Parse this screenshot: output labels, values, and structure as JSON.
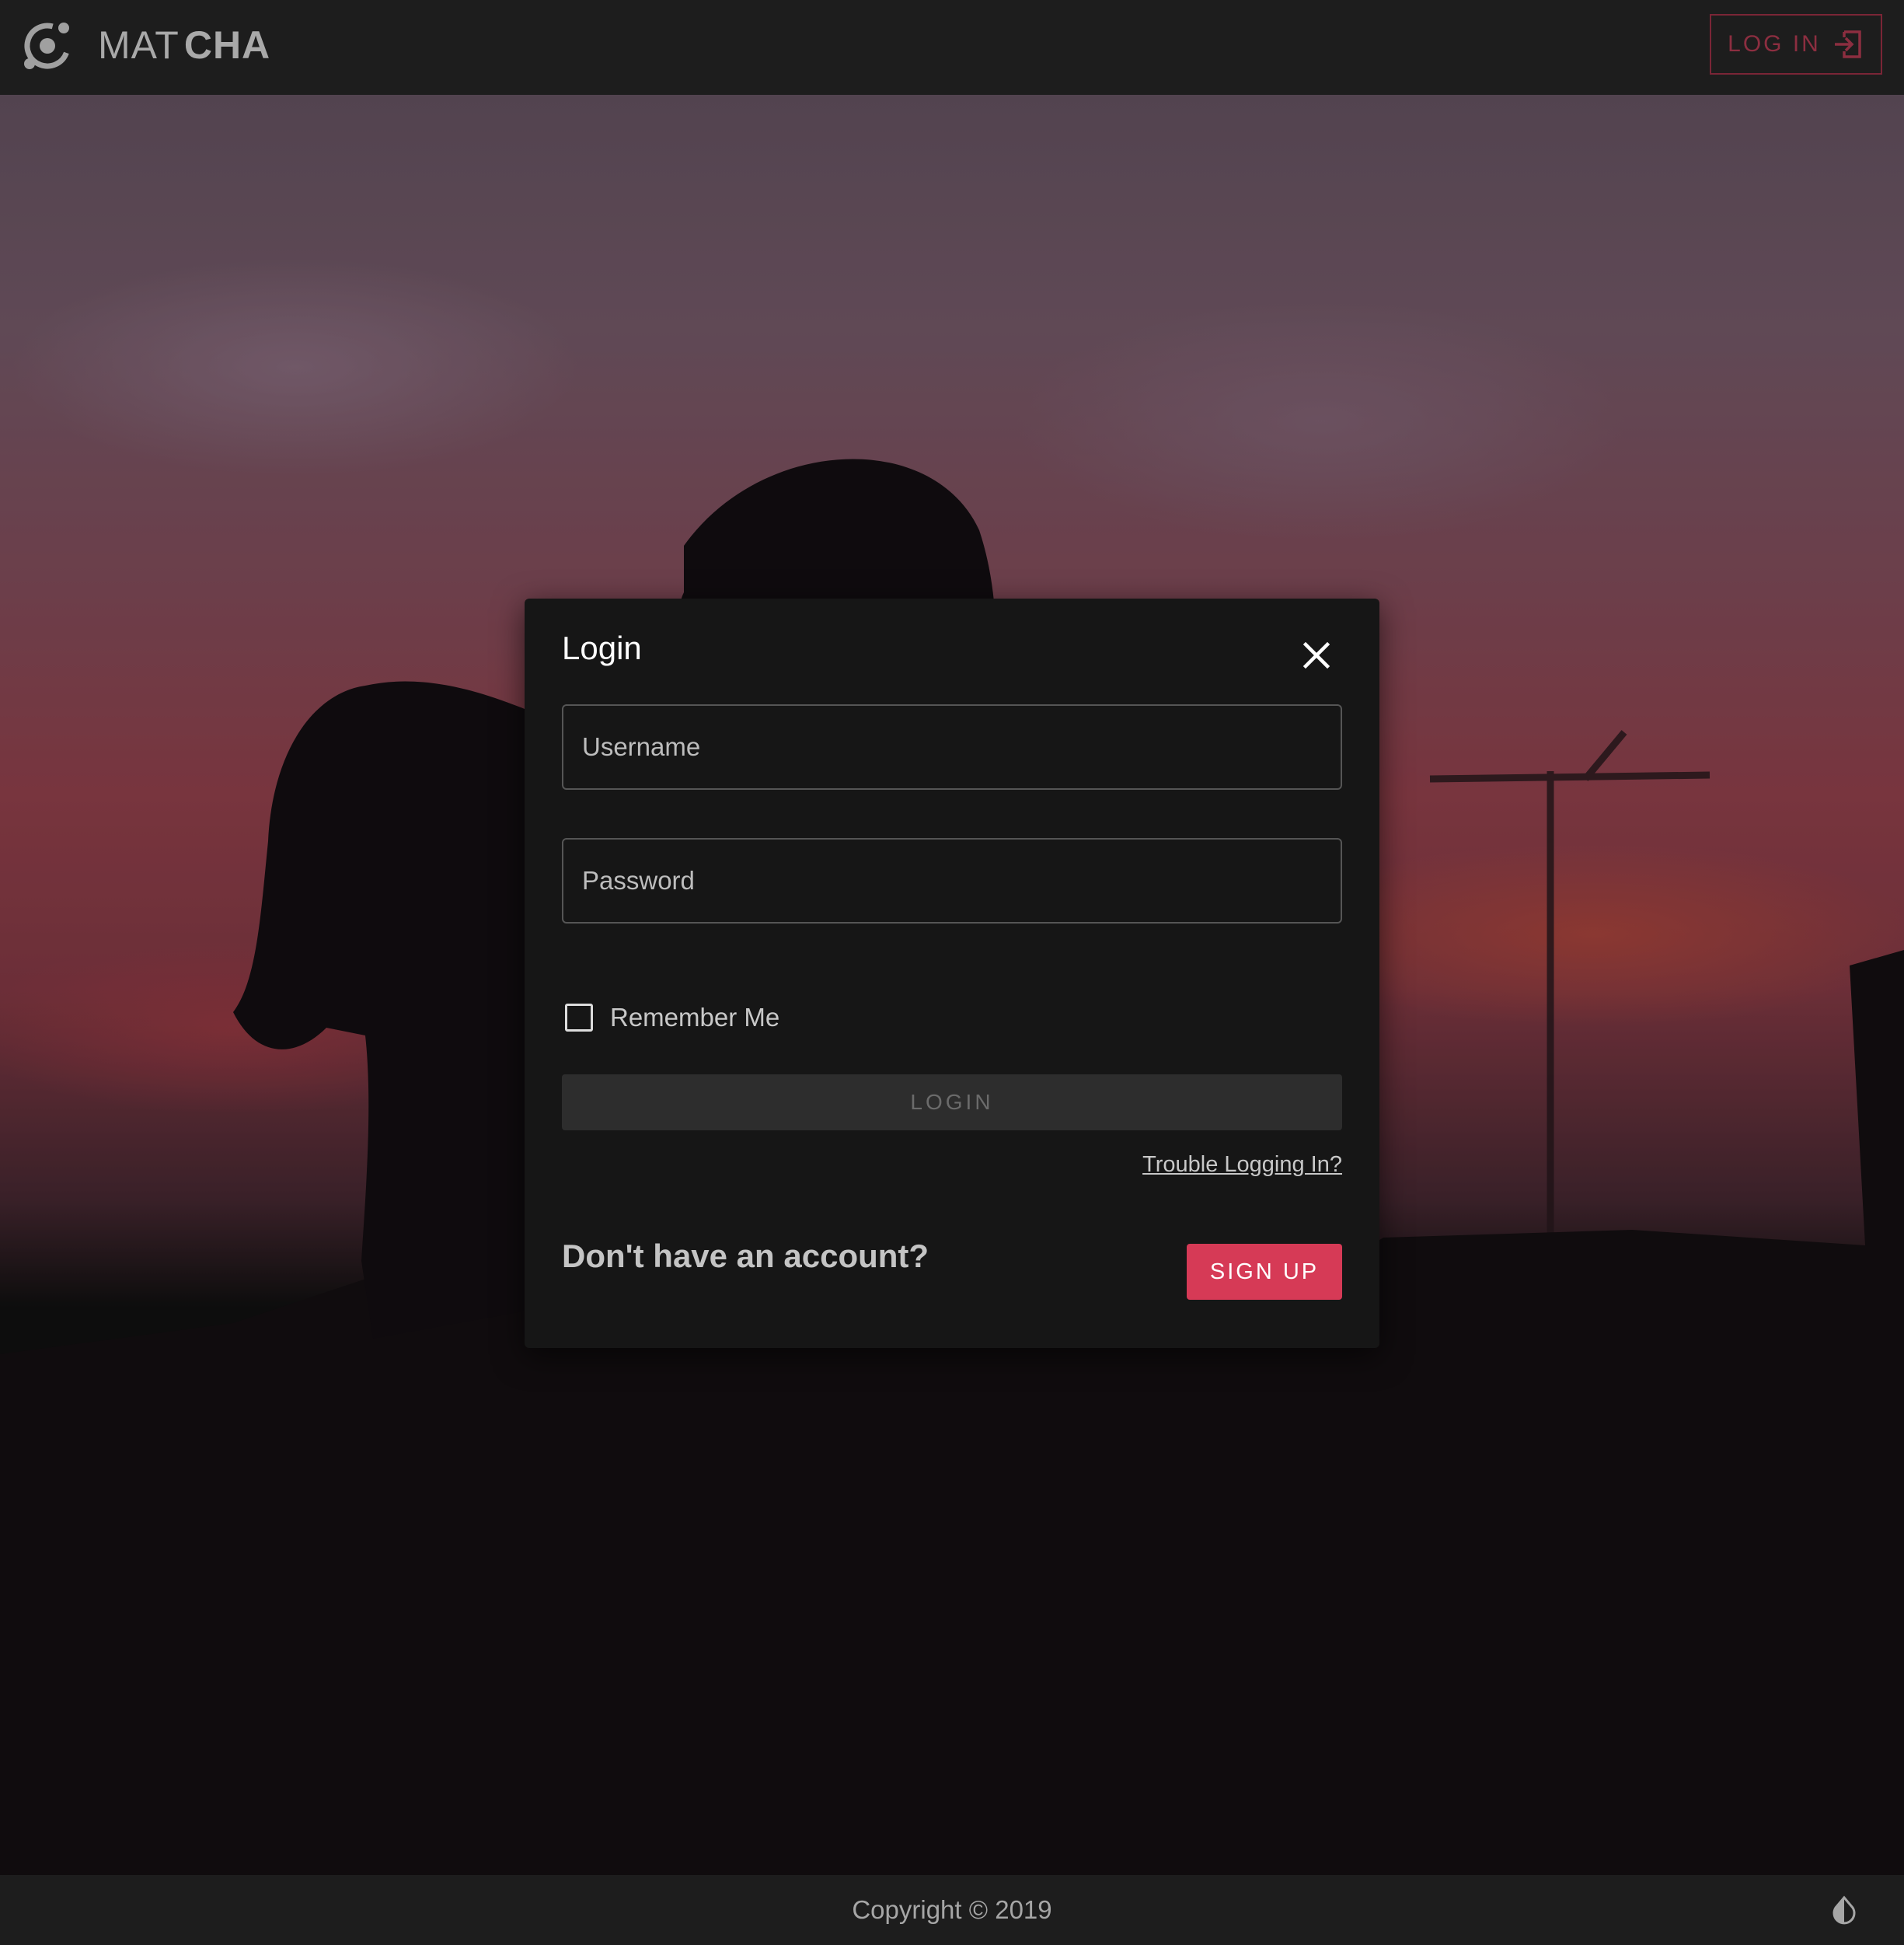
{
  "header": {
    "brand_light": "MAT",
    "brand_bold": "CHA",
    "login_label": "LOG IN",
    "logo_icon": "spinner-orbit-icon",
    "login_icon": "sign-in-icon"
  },
  "modal": {
    "title": "Login",
    "close_icon": "close-icon",
    "username": {
      "placeholder": "Username",
      "value": ""
    },
    "password": {
      "placeholder": "Password",
      "value": ""
    },
    "remember_label": "Remember Me",
    "remember_checked": false,
    "login_label": "LOGIN",
    "trouble_label": "Trouble Logging In?",
    "no_account_text": "Don't have an account?",
    "signup_label": "SIGN UP"
  },
  "footer": {
    "copyright": "Copyright © 2019",
    "theme_icon": "invert-colors-icon"
  },
  "colors": {
    "accent": "#d63a56",
    "header_bg": "#1d1d1d",
    "modal_bg": "#161616",
    "page_bg": "#111111"
  }
}
